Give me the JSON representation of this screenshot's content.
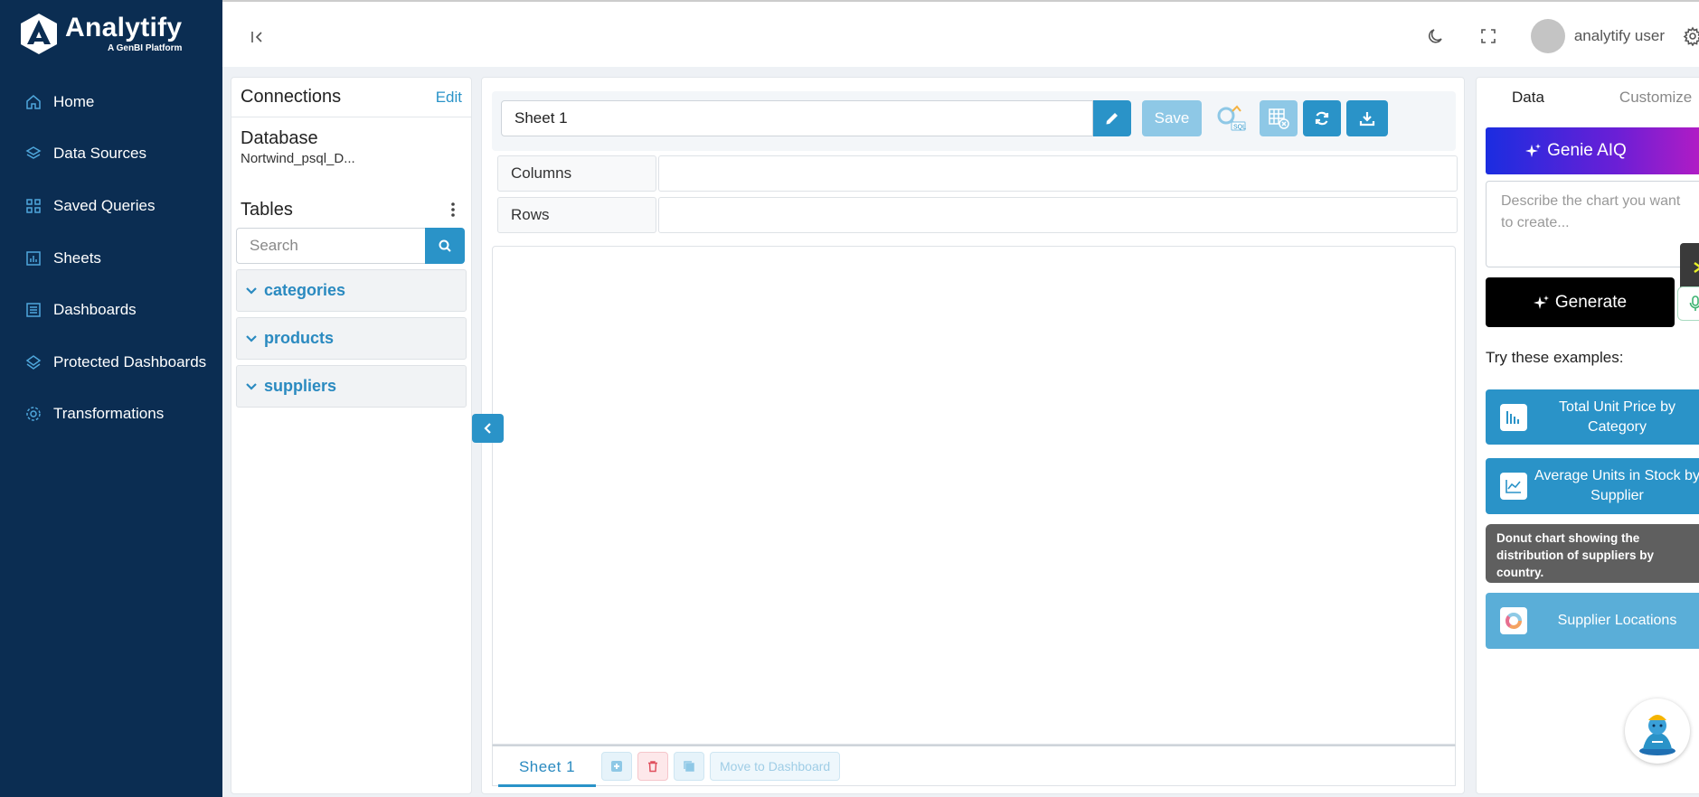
{
  "brand": {
    "name": "Analytify",
    "tagline": "A GenBI Platform"
  },
  "sidebar": {
    "items": [
      {
        "label": "Home",
        "icon": "home-icon"
      },
      {
        "label": "Data Sources",
        "icon": "layers-icon"
      },
      {
        "label": "Saved Queries",
        "icon": "grid-icon"
      },
      {
        "label": "Sheets",
        "icon": "bar-chart-icon"
      },
      {
        "label": "Dashboards",
        "icon": "list-icon"
      },
      {
        "label": "Protected Dashboards",
        "icon": "layers-icon"
      },
      {
        "label": "Transformations",
        "icon": "radar-icon"
      }
    ]
  },
  "topbar": {
    "username": "analytify user"
  },
  "connections": {
    "title": "Connections",
    "edit_label": "Edit",
    "database_label": "Database",
    "database_name": "Nortwind_psql_D...",
    "tables_title": "Tables",
    "search_placeholder": "Search",
    "tables": [
      "categories",
      "products",
      "suppliers"
    ]
  },
  "editor": {
    "sheet_name": "Sheet 1",
    "save_label": "Save",
    "columns_label": "Columns",
    "rows_label": "Rows",
    "tabs": [
      "Sheet 1"
    ],
    "move_label": "Move to Dashboard"
  },
  "right_panel": {
    "tab_data": "Data",
    "tab_customize": "Customize",
    "genie_label": "Genie AIQ",
    "prompt_placeholder": "Describe the chart you want to create...",
    "generate_label": "Generate",
    "try_label": "Try these examples:",
    "examples": [
      {
        "label": "Total Unit Price by Category"
      },
      {
        "label": "Average Units in Stock by Supplier"
      },
      {
        "label": "Supplier Locations"
      }
    ],
    "tooltip": "Donut chart showing the distribution of suppliers by country."
  },
  "colors": {
    "sidebar_bg": "#0b2d52",
    "accent": "#2a93c8",
    "genie_gradient_start": "#1b2de0",
    "genie_gradient_end": "#b31cc4"
  }
}
